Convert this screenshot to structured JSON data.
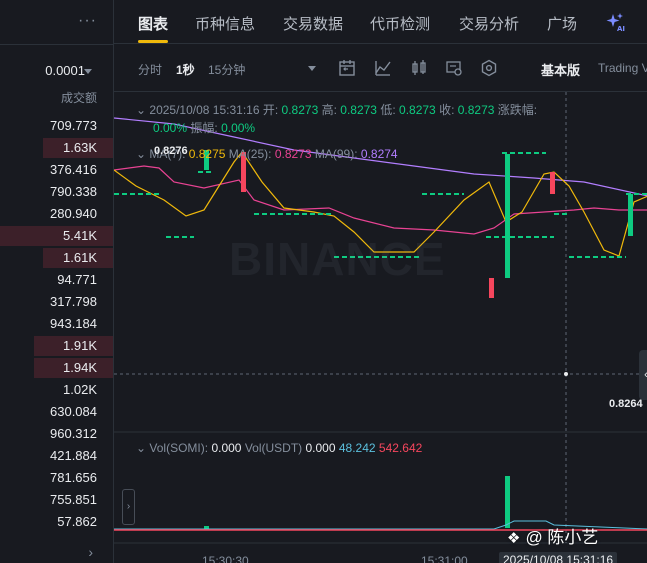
{
  "orderbook": {
    "more_label": "···",
    "precision": "0.0001",
    "column_header": "成交额",
    "rows": [
      {
        "vol": "709.773",
        "depth": 0.0
      },
      {
        "vol": "1.63K",
        "depth": 0.62
      },
      {
        "vol": "376.416",
        "depth": 0.0
      },
      {
        "vol": "790.338",
        "depth": 0.0
      },
      {
        "vol": "280.940",
        "depth": 0.0
      },
      {
        "vol": "5.41K",
        "depth": 1.0
      },
      {
        "vol": "1.61K",
        "depth": 0.62
      },
      {
        "vol": "94.771",
        "depth": 0.0
      },
      {
        "vol": "317.798",
        "depth": 0.0
      },
      {
        "vol": "943.184",
        "depth": 0.0
      },
      {
        "vol": "1.91K",
        "depth": 0.7
      },
      {
        "vol": "1.94K",
        "depth": 0.7
      },
      {
        "vol": "1.02K",
        "depth": 0.0
      },
      {
        "vol": "630.084",
        "depth": 0.0
      },
      {
        "vol": "960.312",
        "depth": 0.0
      },
      {
        "vol": "421.884",
        "depth": 0.0
      },
      {
        "vol": "781.656",
        "depth": 0.0
      },
      {
        "vol": "755.851",
        "depth": 0.0
      },
      {
        "vol": "57.862",
        "depth": 0.0
      }
    ],
    "expand_label": "›"
  },
  "tabs": [
    {
      "label": "图表",
      "active": true
    },
    {
      "label": "币种信息",
      "active": false
    },
    {
      "label": "交易数据",
      "active": false
    },
    {
      "label": "代币检测",
      "active": false
    },
    {
      "label": "交易分析",
      "active": false
    },
    {
      "label": "广场",
      "active": false
    }
  ],
  "toolbar": {
    "intervals": [
      {
        "label": "分时",
        "active": false
      },
      {
        "label": "1秒",
        "active": true
      },
      {
        "label": "15分钟",
        "active": false
      }
    ],
    "icons": [
      "calendar-icon",
      "indicator-icon",
      "candle-type-icon",
      "depth-icon",
      "settings-icon"
    ],
    "version_label": "基本版",
    "trading_view_label": "Trading V"
  },
  "ohlc": {
    "datetime": "2025/10/08 15:31:16",
    "open_label": "开:",
    "open": "0.8273",
    "high_label": "高:",
    "high": "0.8273",
    "low_label": "低:",
    "low": "0.8273",
    "close_label": "收:",
    "close": "0.8273",
    "change_label": "涨跌幅:",
    "change": "0.00%",
    "amplitude_label": "振幅:",
    "amplitude": "0.00%"
  },
  "ma": {
    "ma7_label": "MA(7):",
    "ma7": "0.8275",
    "ma25_label": "MA(25):",
    "ma25": "0.8273",
    "ma99_label": "MA(99):",
    "ma99": "0.8274"
  },
  "price_high_label": "0.8276",
  "price_low_label": "0.8264",
  "watermark": "BINANCE",
  "volume": {
    "vol_somi_label": "Vol(SOMI):",
    "vol_somi": "0.000",
    "vol_usdt_label": "Vol(USDT)",
    "vol_usdt": "0.000",
    "vol_v1": "48.242",
    "vol_v2": "542.642"
  },
  "time_axis": [
    "15:30:30",
    "15:31:00"
  ],
  "crosshair_time": "2025/10/08 15:31:16",
  "wechat_watermark": "@ 陈小艺",
  "colors": {
    "up": "#0ecb81",
    "down": "#f6465d",
    "ma7": "#f0b90b",
    "ma25": "#e84393",
    "ma99": "#b27eff",
    "accent": "#f0b90b"
  }
}
